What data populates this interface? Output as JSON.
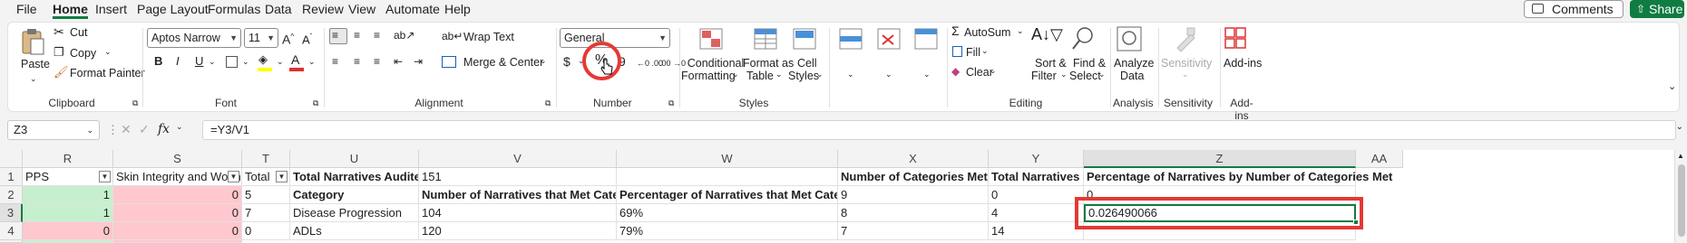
{
  "menu": {
    "file": "File",
    "home": "Home",
    "insert": "Insert",
    "page_layout": "Page Layout",
    "formulas": "Formulas",
    "data": "Data",
    "review": "Review",
    "view": "View",
    "automate": "Automate",
    "help": "Help"
  },
  "top_buttons": {
    "comments": "Comments",
    "share": "Share"
  },
  "clipboard": {
    "paste": "Paste",
    "cut": "Cut",
    "copy": "Copy",
    "format_painter": "Format Painter",
    "label": "Clipboard"
  },
  "font": {
    "name": "Aptos Narrow",
    "size": "11",
    "label": "Font",
    "bold": "B",
    "italic": "I",
    "underline": "U"
  },
  "alignment": {
    "wrap_text": "Wrap Text",
    "merge_center": "Merge & Center",
    "label": "Alignment"
  },
  "number": {
    "format": "General",
    "dollar": "$",
    "percent": "%",
    "comma": "9",
    "inc_decimal": "←0 .00",
    "dec_decimal": ".00 →0",
    "label": "Number"
  },
  "styles": {
    "conditional_1": "Conditional",
    "conditional_2": "Formatting",
    "table_1": "Format as",
    "table_2": "Table",
    "cell_1": "Cell",
    "cell_2": "Styles",
    "label": "Styles"
  },
  "cells": {
    "r1": {
      "R": "PPS",
      "S": "Skin Integrity and Wound",
      "T": "Total",
      "U": "Total Narratives Audited",
      "V": "151",
      "X": "Number of Categories Met",
      "Y": "Total Narratives",
      "Z": "Percentage of Narratives by Number of Categories Met"
    },
    "r2": {
      "R": "1",
      "S": "0",
      "T": "5",
      "U": "Category",
      "V": "Number of Narratives that Met Category",
      "W": "Percentager of Narratives that Met Category",
      "X": "9",
      "Y": "0",
      "Z": "0"
    },
    "r3": {
      "R": "1",
      "S": "0",
      "T": "7",
      "U": "Disease Progression",
      "V": "104",
      "W": "69%",
      "X": "8",
      "Y": "4",
      "Z": "0.026490066"
    },
    "r4": {
      "R": "0",
      "S": "0",
      "T": "0",
      "U": "ADLs",
      "V": "120",
      "W": "79%",
      "X": "7",
      "Y": "14"
    }
  },
  "editing": {
    "autosum": "AutoSum",
    "fill": "Fill",
    "clear": "Clear",
    "sort_1": "Sort &",
    "sort_2": "Filter",
    "find_1": "Find &",
    "find_2": "Select",
    "label": "Editing"
  },
  "analysis": {
    "analyze_1": "Analyze",
    "analyze_2": "Data",
    "label": "Analysis"
  },
  "sensitivity": {
    "button": "Sensitivity",
    "label": "Sensitivity"
  },
  "addins": {
    "button": "Add-ins",
    "label": "Add-ins"
  },
  "formula_bar": {
    "name_box": "Z3",
    "fx": "fx",
    "formula": "=Y3/V1"
  },
  "columns": [
    "R",
    "S",
    "T",
    "U",
    "V",
    "W",
    "X",
    "Y",
    "Z",
    "AA"
  ],
  "rows": [
    "1",
    "2",
    "3",
    "4"
  ],
  "colors": {
    "accent": "#107c41",
    "green_fill": "#c6efce",
    "pink_fill": "#ffc7ce",
    "highlight": "#e53935"
  }
}
